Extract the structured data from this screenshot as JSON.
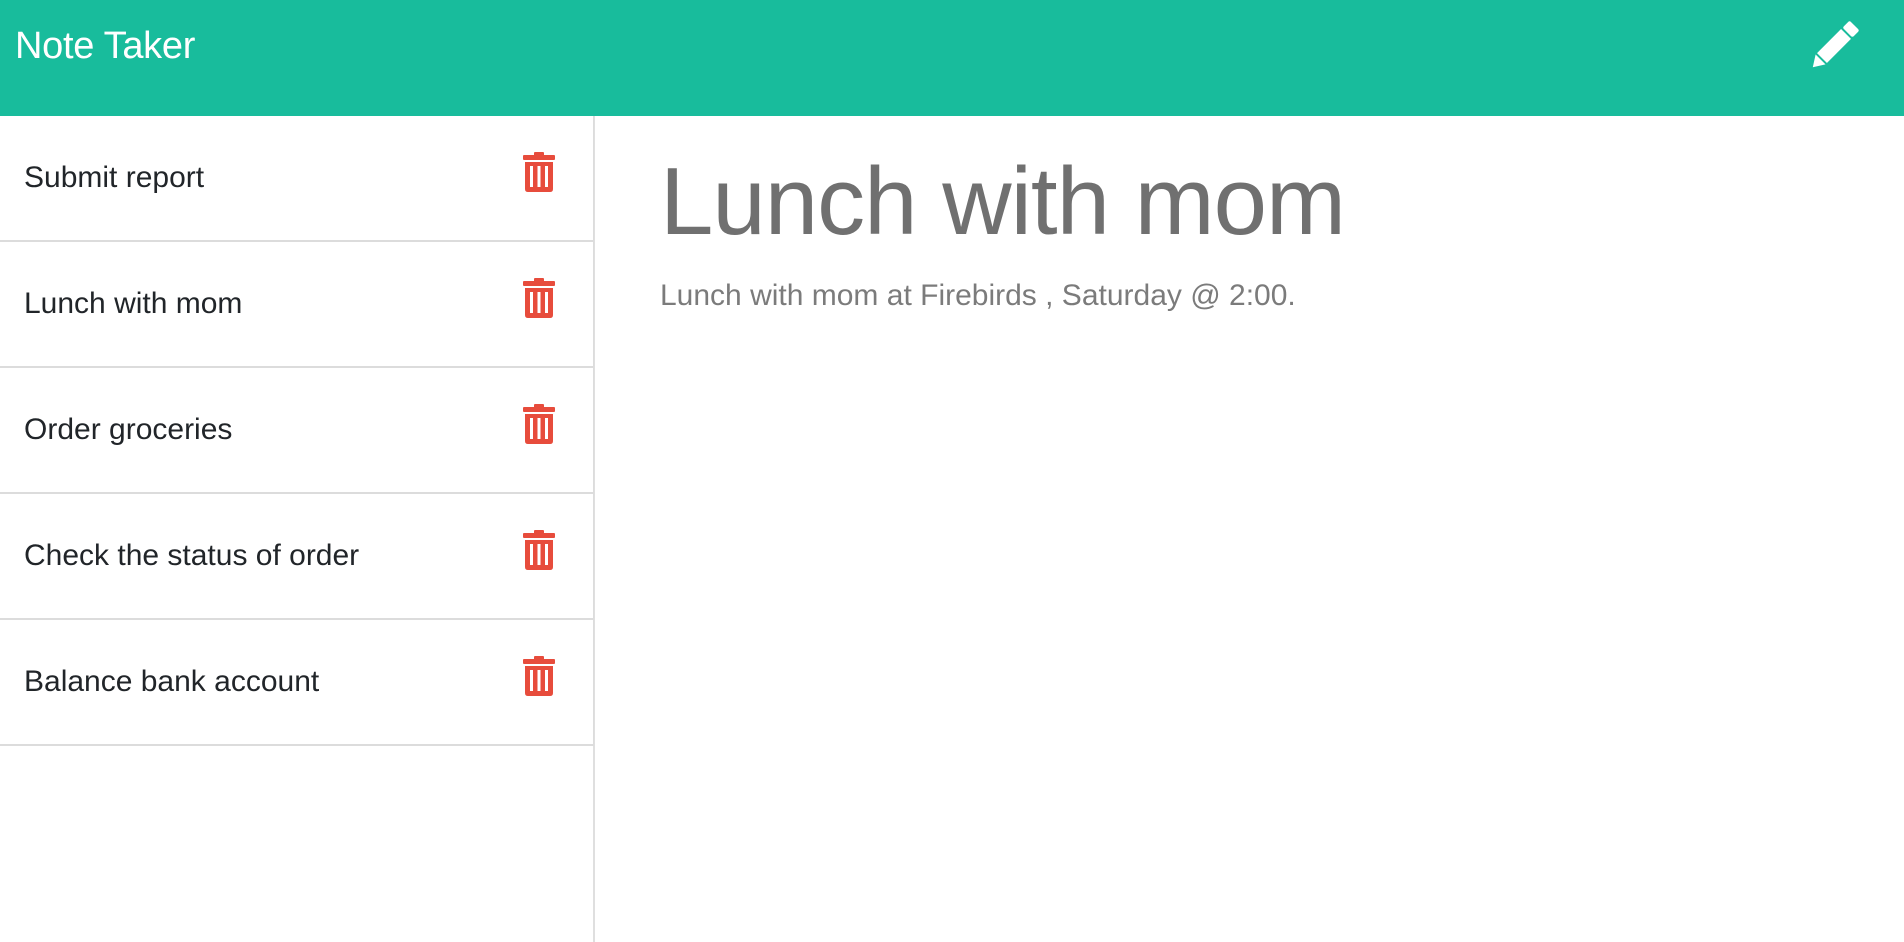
{
  "header": {
    "title": "Note Taker",
    "new_note_icon": "pencil-icon",
    "background": "#18bc9c"
  },
  "sidebar": {
    "delete_icon": "trash-icon",
    "delete_color": "#e74c3c",
    "notes": [
      {
        "title": "Submit report"
      },
      {
        "title": "Lunch with mom"
      },
      {
        "title": "Order groceries"
      },
      {
        "title": "Check the status of order"
      },
      {
        "title": "Balance bank account"
      }
    ]
  },
  "active_note": {
    "title": "Lunch with mom",
    "text": "Lunch with mom at Firebirds , Saturday @ 2:00."
  }
}
